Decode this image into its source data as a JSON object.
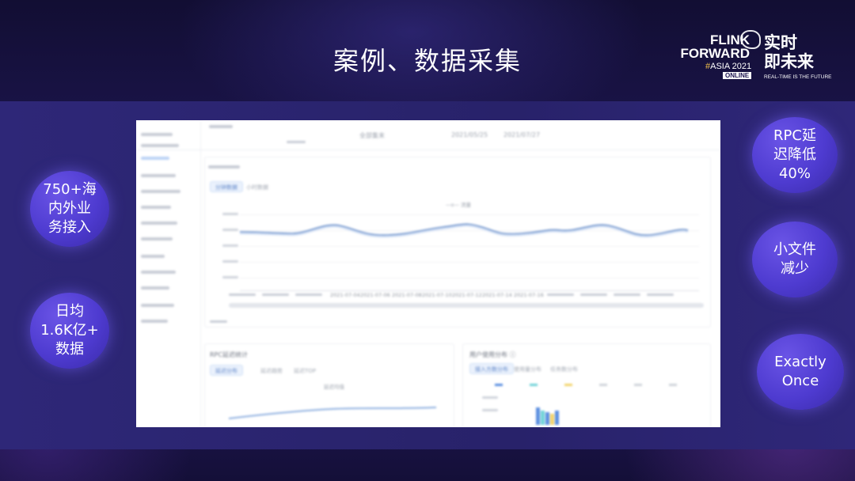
{
  "slide": {
    "title": "案例、数据采集"
  },
  "logo": {
    "line1": "FLINK",
    "line2": "FORWARD",
    "hash": "#",
    "asia": "ASIA 2021",
    "online": "ONLINE",
    "cn_line1": "实时",
    "cn_line2": "即未来",
    "tagline": "REAL-TIME IS THE FUTURE"
  },
  "bubbles": {
    "left": [
      {
        "text": "750+海\n内外业\n务接入"
      },
      {
        "text": "日均\n1.6K亿+\n数据"
      }
    ],
    "right": [
      {
        "text": "RPC延\n迟降低\n40%"
      },
      {
        "text": "小文件\n减少"
      },
      {
        "text": "Exactly\nOnce"
      }
    ]
  },
  "screenshot": {
    "topbar": {
      "filter_label": "全部集末",
      "date_start": "2021/05/25",
      "date_end": "2021/07/27"
    },
    "main_chart": {
      "tabs": [
        "分钟数据",
        "小时数据"
      ],
      "legend": "—o— 流量",
      "x_ticks": [
        "2021-07-04",
        "2021-07-06",
        "2021-07-08",
        "2021-07-10",
        "2021-07-12",
        "2021-07-14",
        "2021-07-16"
      ]
    },
    "bottom_left": {
      "title": "RPC延迟统计",
      "tabs": [
        "延迟分布",
        "延迟趋势",
        "延迟TOP"
      ],
      "legend": "延迟均值"
    },
    "bottom_right": {
      "title": "用户使用分布 ⓘ",
      "tabs": [
        "接入方数分布",
        "使用量分布",
        "任务数分布"
      ]
    }
  },
  "colors": {
    "bubble": "#4e3bd0",
    "band": "#2b2570",
    "background": "#1a1443",
    "chart_line": "#6a8fc9"
  }
}
